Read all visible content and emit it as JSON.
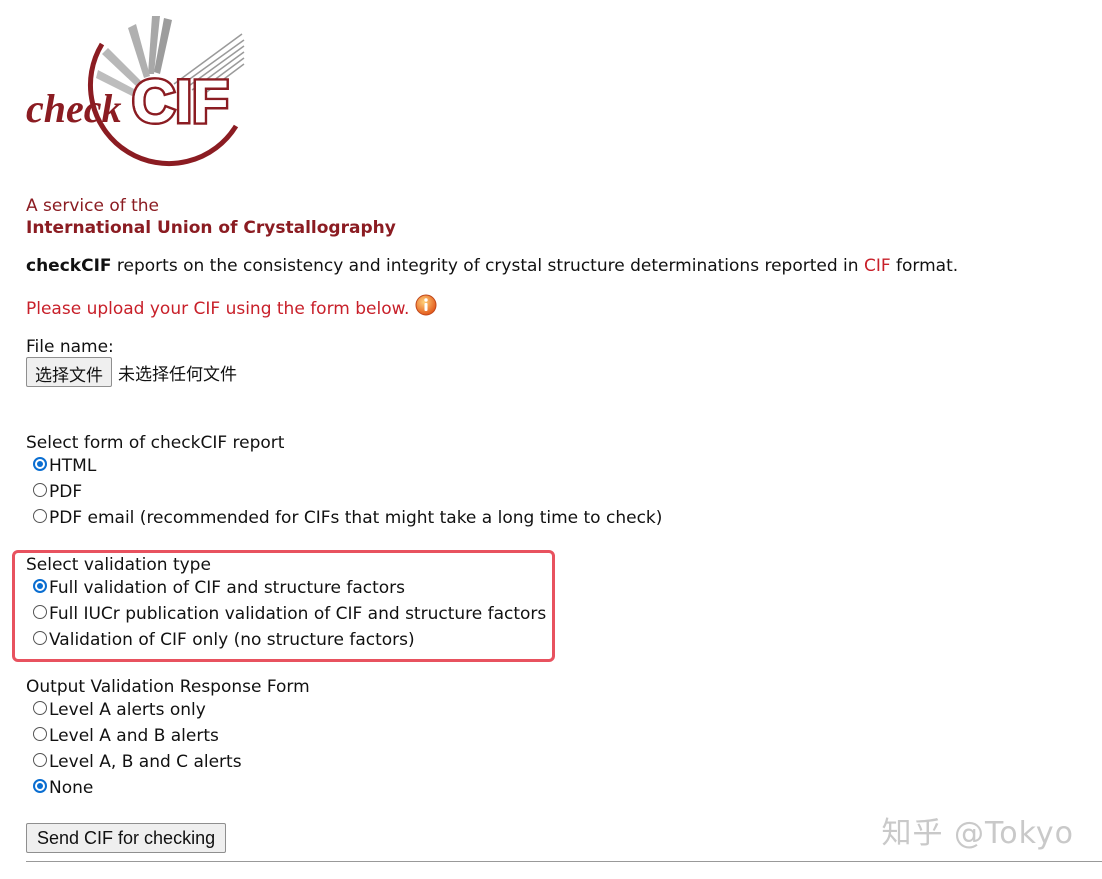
{
  "header": {
    "logo_text": "checkCIF",
    "service_line1": "A service of the",
    "service_line2": "International Union of Crystallography"
  },
  "intro": {
    "brand": "checkCIF",
    "text_before_cif": " reports on the consistency and integrity of crystal structure determinations reported in ",
    "cif_word": "CIF",
    "text_after_cif": " format."
  },
  "upload_prompt": "Please upload your CIF using the form below.",
  "file": {
    "label": "File name:",
    "button_label": "选择文件",
    "status": "未选择任何文件"
  },
  "report_form": {
    "label": "Select form of checkCIF report",
    "options": [
      {
        "label": "HTML",
        "selected": true
      },
      {
        "label": "PDF",
        "selected": false
      },
      {
        "label": "PDF email (recommended for CIFs that might take a long time to check)",
        "selected": false
      }
    ]
  },
  "validation_type": {
    "label": "Select validation type",
    "options": [
      {
        "label": "Full validation of CIF and structure factors",
        "selected": true
      },
      {
        "label": "Full IUCr publication validation of CIF and structure factors",
        "selected": false
      },
      {
        "label": "Validation of CIF only (no structure factors)",
        "selected": false
      }
    ]
  },
  "output_form": {
    "label": "Output Validation Response Form",
    "options": [
      {
        "label": "Level A alerts only",
        "selected": false
      },
      {
        "label": "Level A and B alerts",
        "selected": false
      },
      {
        "label": "Level A, B and C alerts",
        "selected": false
      },
      {
        "label": "None",
        "selected": true
      }
    ]
  },
  "submit_label": "Send CIF for checking",
  "watermark": "知乎 @Tokyo",
  "colors": {
    "brand": "#8b1c22",
    "prompt_red": "#c8202a",
    "radio_blue": "#0a6ed1",
    "highlight": "#e8525f"
  }
}
